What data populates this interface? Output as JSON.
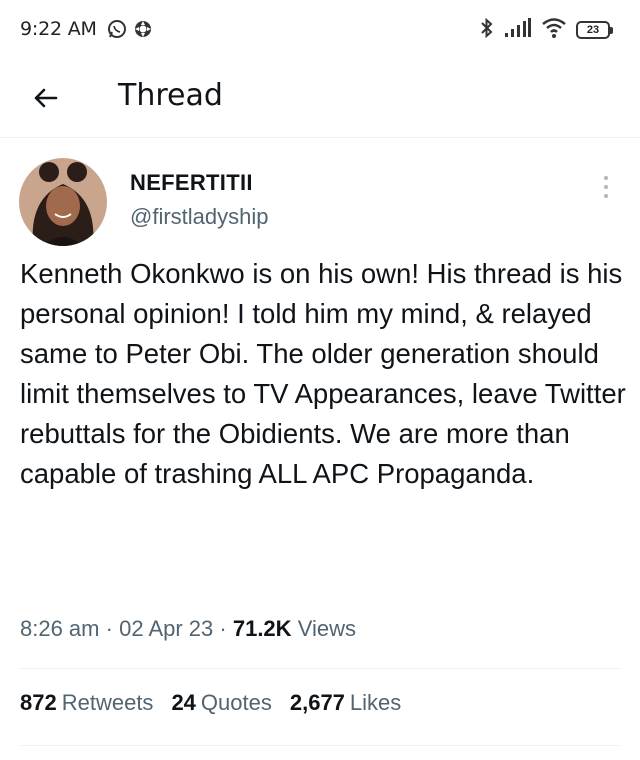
{
  "status_bar": {
    "time": "9:22 AM",
    "battery": "23",
    "icons": [
      "whatsapp-icon",
      "app-notification-icon",
      "bluetooth-icon",
      "signal-icon",
      "wifi-icon",
      "battery-icon"
    ]
  },
  "header": {
    "title": "Thread",
    "back_icon": "arrow-left-icon"
  },
  "tweet": {
    "author_name": "NEFERTITII",
    "author_handle": "@firstladyship",
    "text": "Kenneth Okonkwo is on his own! His thread is his personal opinion! I told him my mind, & relayed same to Peter Obi. The older generation should limit themselves to TV Appearances, leave Twitter rebuttals for the Obidients. We are more than capable of trashing ALL APC Propaganda.",
    "time": "8:26 am",
    "date": "02 Apr 23",
    "views_count": "71.2K",
    "views_label": "Views",
    "separator": "·"
  },
  "stats": {
    "retweets": {
      "count": "872",
      "label": "Retweets"
    },
    "quotes": {
      "count": "24",
      "label": "Quotes"
    },
    "likes": {
      "count": "2,677",
      "label": "Likes"
    }
  },
  "colors": {
    "text_primary": "#0f1419",
    "text_secondary": "#536471",
    "divider": "#eff3f4"
  }
}
